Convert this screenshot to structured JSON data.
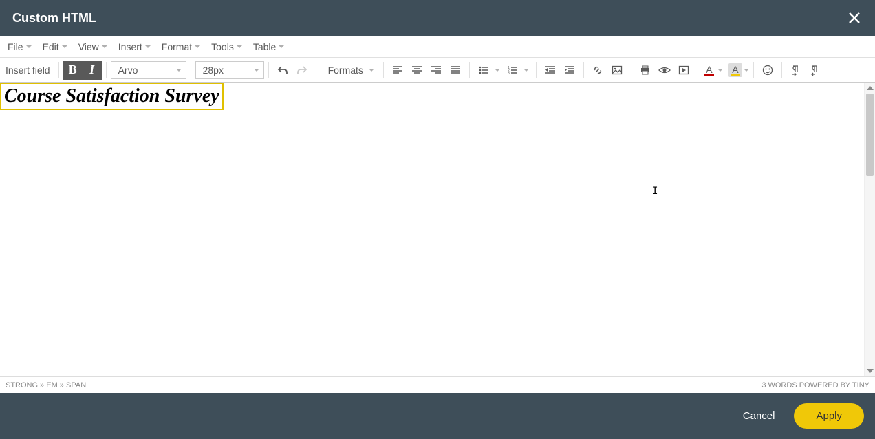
{
  "header": {
    "title": "Custom HTML"
  },
  "menubar": {
    "items": [
      {
        "label": "File"
      },
      {
        "label": "Edit"
      },
      {
        "label": "View"
      },
      {
        "label": "Insert"
      },
      {
        "label": "Format"
      },
      {
        "label": "Tools"
      },
      {
        "label": "Table"
      }
    ]
  },
  "toolbar": {
    "insert_field": "Insert field",
    "bold_label": "B",
    "italic_label": "I",
    "font_family": "Arvo",
    "font_size": "28px",
    "formats_label": "Formats",
    "text_color": "#c00000",
    "bg_color": "#f0c808",
    "letter_A": "A"
  },
  "editor": {
    "content": "Course Satisfaction Survey"
  },
  "statusbar": {
    "path": "STRONG » EM » SPAN",
    "right": "3 WORDS POWERED BY TINY"
  },
  "footer": {
    "cancel": "Cancel",
    "apply": "Apply"
  }
}
